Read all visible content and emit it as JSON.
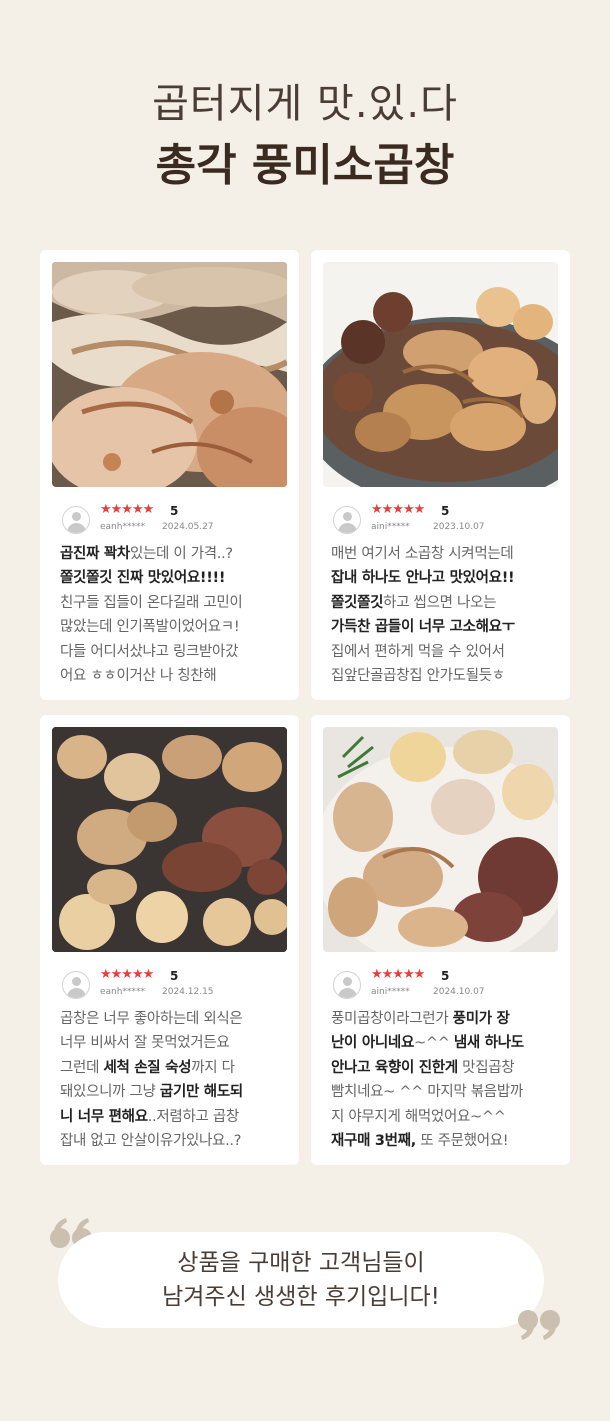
{
  "headline": {
    "sub": "곱터지게 맛.있.다",
    "main": "총각 풍미소곱창"
  },
  "reviews": [
    {
      "photo_desc": "grilled-gopchang-closeup",
      "stars": "★★★★★",
      "score": "5",
      "user": "eanh*****",
      "date": "2024.05.27",
      "lines": [
        [
          {
            "t": "곱진짜 꽉차",
            "b": true
          },
          {
            "t": "있는데 이 가격..?",
            "b": false
          }
        ],
        [
          {
            "t": "쫄깃쫄깃 진짜 맛있어요!!!!",
            "b": true
          }
        ],
        [
          {
            "t": "친구들 집들이 온다길래 고민이",
            "b": false
          }
        ],
        [
          {
            "t": "많았는데 인기폭발이었어요ㅋ!",
            "b": false
          }
        ],
        [
          {
            "t": "다들 어디서샀냐고 링크받아갔",
            "b": false
          }
        ],
        [
          {
            "t": "어요 ㅎㅎ이거산 나 칭찬해",
            "b": false
          }
        ]
      ]
    },
    {
      "photo_desc": "gopchang-plate",
      "stars": "★★★★★",
      "score": "5",
      "user": "aini*****",
      "date": "2023.10.07",
      "lines": [
        [
          {
            "t": "매번 여기서 소곱창 시켜먹는데",
            "b": false
          }
        ],
        [
          {
            "t": "잡내 하나도 안나고 맛있어요!!",
            "b": true
          }
        ],
        [
          {
            "t": "쫄깃쫄깃",
            "b": true
          },
          {
            "t": "하고 씹으면 나오는",
            "b": false
          }
        ],
        [
          {
            "t": "가득찬 곱들이 너무 고소해요ㅜ",
            "b": true
          }
        ],
        [
          {
            "t": "집에서 편하게 먹을 수 있어서",
            "b": false
          }
        ],
        [
          {
            "t": "집앞단골곱창집 안가도될듯ㅎ",
            "b": false
          }
        ]
      ]
    },
    {
      "photo_desc": "gopchang-in-pan",
      "stars": "★★★★★",
      "score": "5",
      "user": "eanh*****",
      "date": "2024.12.15",
      "lines": [
        [
          {
            "t": "곱창은 너무 좋아하는데 외식은",
            "b": false
          }
        ],
        [
          {
            "t": "너무 비싸서 잘 못먹었거든요",
            "b": false
          }
        ],
        [
          {
            "t": "그런데 ",
            "b": false
          },
          {
            "t": "세척 손질 숙성",
            "b": true
          },
          {
            "t": "까지 다",
            "b": false
          }
        ],
        [
          {
            "t": "돼있으니까 그냥 ",
            "b": false
          },
          {
            "t": "굽기만 해도되",
            "b": true
          }
        ],
        [
          {
            "t": "니 너무 편해요",
            "b": true
          },
          {
            "t": "..저렴하고 곱창",
            "b": false
          }
        ],
        [
          {
            "t": "잡내 없고 안살이유가있나요..?",
            "b": false
          }
        ]
      ]
    },
    {
      "photo_desc": "gopchang-bowl",
      "stars": "★★★★★",
      "score": "5",
      "user": "aini*****",
      "date": "2024.10.07",
      "lines": [
        [
          {
            "t": "풍미곱창이라그런가 ",
            "b": false
          },
          {
            "t": "풍미가 장",
            "b": true
          }
        ],
        [
          {
            "t": "난이 아니네요",
            "b": true
          },
          {
            "t": "~^^ ",
            "b": false
          },
          {
            "t": "냄새 하나도",
            "b": true
          }
        ],
        [
          {
            "t": "안나고 육향이 진한게",
            "b": true
          },
          {
            "t": " 맛집곱창",
            "b": false
          }
        ],
        [
          {
            "t": "빰치네요~  ^^ 마지막 볶음밥까",
            "b": false
          }
        ],
        [
          {
            "t": "지 야무지게 해먹었어요~^^",
            "b": false
          }
        ],
        [
          {
            "t": "재구매 3번째,",
            "b": true
          },
          {
            "t": " 또 주문했어요!",
            "b": false
          }
        ]
      ]
    }
  ],
  "closing": {
    "line1": "상품을 구매한 고객님들이",
    "line2": "남겨주신 생생한 후기입니다!"
  },
  "colors": {
    "background": "#f4f0e8",
    "star": "#e5403c",
    "quote_mark": "#cbbfb0"
  }
}
